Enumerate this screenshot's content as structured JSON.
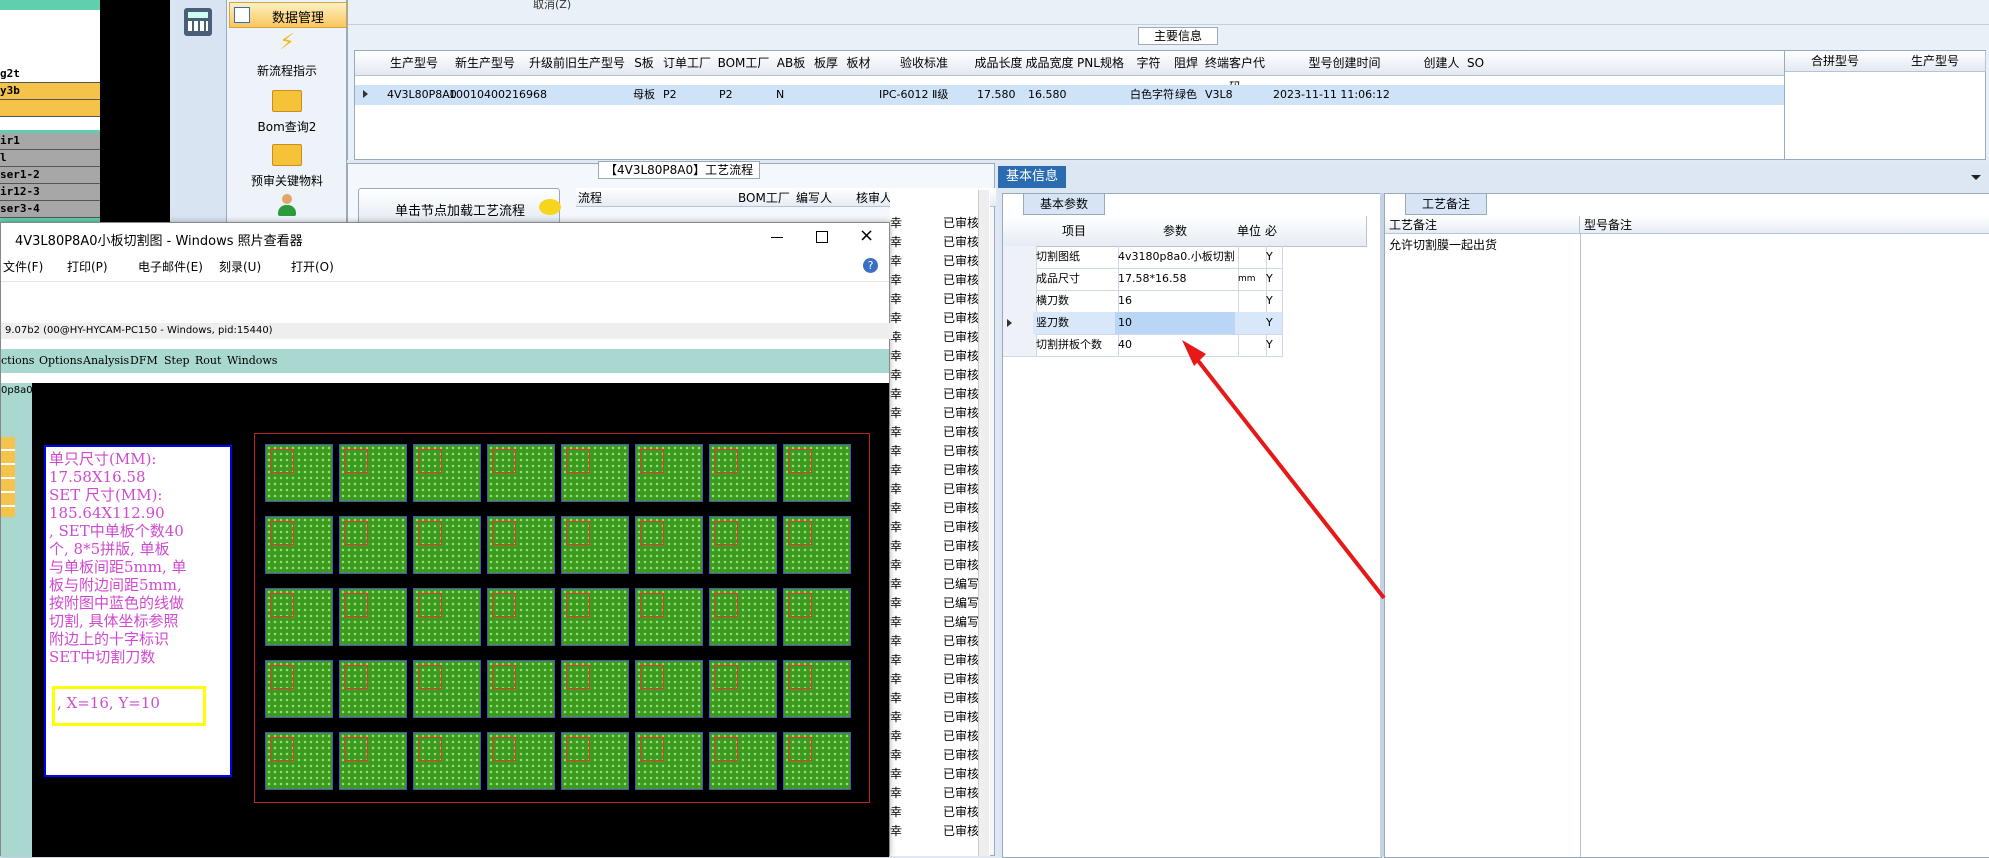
{
  "left_app": {
    "rows": [
      "g2t",
      "y3b",
      "",
      "ir1",
      "l",
      "ser1-2",
      "ir12-3",
      "ser3-4"
    ]
  },
  "nav": {
    "header": "数据管理",
    "items": [
      {
        "label": "新流程指示",
        "icon": "lightning-icon"
      },
      {
        "label": "Bom查询2",
        "icon": "folder-icon"
      },
      {
        "label": "预审关键物料",
        "icon": "folder-icon"
      },
      {
        "label": "",
        "icon": "user-icon"
      }
    ]
  },
  "top": {
    "partial_text": "取消(Z)",
    "section_title": "主要信息",
    "columns": [
      "生产型号",
      "新生产型号",
      "升级前旧生产型号",
      "S板",
      "订单工厂",
      "BOM工厂",
      "AB板",
      "板厚",
      "板材",
      "验收标准",
      "成品长度",
      "成品宽度",
      "PNL规格",
      "字符",
      "阻焊",
      "终端客户代码",
      "型号创建时间",
      "创建人",
      "SO"
    ],
    "row": [
      "4V3L80P8A0",
      "10010400216968",
      "",
      "母板",
      "P2",
      "P2",
      "N",
      "",
      "",
      "IPC-6012 Ⅱ级",
      "17.580",
      "16.580",
      "",
      "白色字符",
      "绿色",
      "V3L8",
      "2023-11-11 11:06:12",
      "",
      ""
    ],
    "right_columns": [
      "合拼型号",
      "生产型号"
    ]
  },
  "flow": {
    "title": "【4V3L80P8A0】工艺流程",
    "load_button": "单击节点加载工艺流程",
    "columns": [
      "流程",
      "BOM工厂",
      "编写人",
      "核审人",
      "状态"
    ],
    "status_values": [
      "已审核",
      "已审核",
      "已审核",
      "已审核",
      "已审核",
      "已审核",
      "已审核",
      "已审核",
      "已审核",
      "已审核",
      "已审核",
      "已审核",
      "已审核",
      "已审核",
      "已审核",
      "已审核",
      "已审核",
      "已审核",
      "已审核",
      "已编写",
      "已编写",
      "已编写",
      "已审核",
      "已审核",
      "已审核",
      "已审核",
      "已审核",
      "已审核",
      "已审核",
      "已审核",
      "已审核",
      "已审核",
      "已审核"
    ],
    "reviewer_char": "幸"
  },
  "info": {
    "panel_title": "基本信息",
    "tab_basic": "基本参数",
    "tab_remark": "工艺备注",
    "columns": [
      "项目",
      "参数",
      "单位",
      "必"
    ],
    "rows": [
      {
        "item": "切割图纸",
        "param": "4v3180p8a0.小板切割",
        "unit": "",
        "req": "Y"
      },
      {
        "item": "成品尺寸",
        "param": "17.58*16.58",
        "unit": "mm",
        "req": "Y"
      },
      {
        "item": "横刀数",
        "param": "16",
        "unit": "",
        "req": "Y"
      },
      {
        "item": "竖刀数",
        "param": "10",
        "unit": "",
        "req": "Y"
      },
      {
        "item": "切割拼板个数",
        "param": "40",
        "unit": "",
        "req": "Y"
      }
    ],
    "remark_columns": [
      "工艺备注",
      "型号备注"
    ],
    "remark_value": "允许切割膜一起出货"
  },
  "viewer": {
    "title": "4V3L80P8A0小板切割图 - Windows 照片查看器",
    "menu": [
      "文件(F)",
      "打印(P)",
      "电子邮件(E)",
      "刻录(U)",
      "打开(O)"
    ],
    "cam_title": "9.07b2 (00@HY-HYCAM-PC150 - Windows, pid:15440)",
    "cam_menu": [
      "ctions",
      "Options",
      "Analysis",
      "DFM",
      "Step",
      "Rout",
      "Windows"
    ],
    "cam_side": "0p8a0",
    "note_lines": [
      "单只尺寸(MM):",
      "17.58X16.58",
      "SET 尺寸(MM):",
      "185.64X112.90",
      ", SET中单板个数40",
      "个, 8*5拼版, 单板",
      "与单板间距5mm, 单",
      "板与附边间距5mm,",
      "按附图中蓝色的线做",
      "切割, 具体坐标参照",
      "附边上的十字标识",
      "SET中切割刀数"
    ],
    "highlight_text": ", X=16, Y=10"
  },
  "colors": {
    "accent": "#2b6cb0",
    "teal": "#5fcfae",
    "arrow": "#e81818",
    "highlight": "#ffff00",
    "note": "#d04ad0"
  }
}
